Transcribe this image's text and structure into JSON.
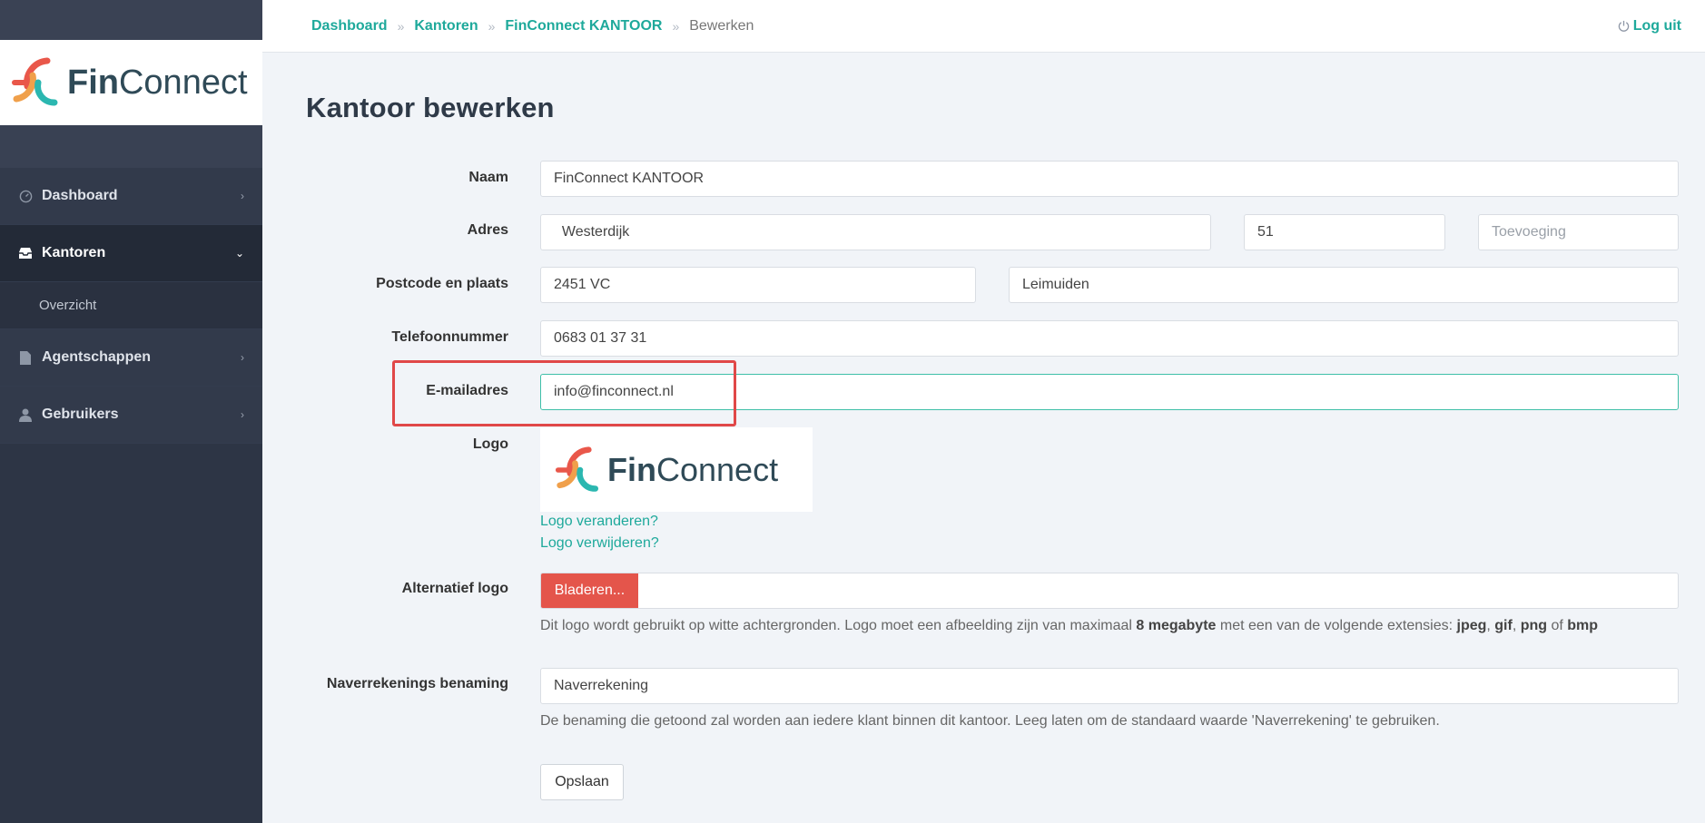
{
  "brand": {
    "name_bold": "Fin",
    "name_rest": "Connect"
  },
  "sidebar": {
    "items": [
      {
        "label": "Dashboard",
        "icon": "dashboard-icon"
      },
      {
        "label": "Kantoren",
        "icon": "inbox-icon"
      },
      {
        "label": "Overzicht"
      },
      {
        "label": "Agentschappen",
        "icon": "document-icon"
      },
      {
        "label": "Gebruikers",
        "icon": "user-icon"
      }
    ]
  },
  "header": {
    "breadcrumb": [
      "Dashboard",
      "Kantoren",
      "FinConnect KANTOOR",
      "Bewerken"
    ],
    "separator": "»",
    "logout": "Log uit"
  },
  "page": {
    "title": "Kantoor bewerken"
  },
  "form": {
    "naam": {
      "label": "Naam",
      "value": "FinConnect KANTOOR"
    },
    "adres": {
      "label": "Adres",
      "street": "  Westerdijk",
      "number": "51",
      "addition_placeholder": "Toevoeging"
    },
    "postcode": {
      "label": "Postcode en plaats",
      "postcode": "2451 VC",
      "plaats": "Leimuiden"
    },
    "telefoon": {
      "label": "Telefoonnummer",
      "value": "0683 01 37 31"
    },
    "email": {
      "label": "E-mailadres",
      "value": "info@finconnect.nl"
    },
    "logo": {
      "label": "Logo",
      "change_link": "Logo veranderen?",
      "remove_link": "Logo verwijderen?"
    },
    "alt_logo": {
      "label": "Alternatief logo",
      "browse": "Bladeren...",
      "help_1": "Dit logo wordt gebruikt op witte achtergronden. Logo moet een afbeelding zijn van maximaal ",
      "help_size": "8 megabyte",
      "help_2": " met een van de volgende extensies: ",
      "ext_1": "jpeg",
      "ext_2": "gif",
      "ext_3": "png",
      "ext_4": "bmp",
      "comma": ", ",
      "of": " of "
    },
    "naverrekening": {
      "label": "Naverrekenings benaming",
      "value": "Naverrekening",
      "help": "De benaming die getoond zal worden aan iedere klant binnen dit kantoor. Leeg laten om de standaard waarde 'Naverrekening' te gebruiken."
    },
    "save": "Opslaan"
  },
  "colors": {
    "accent": "#1ea99b",
    "sidebar": "#2d3545",
    "danger": "#e4554b",
    "highlight": "#e04848"
  }
}
